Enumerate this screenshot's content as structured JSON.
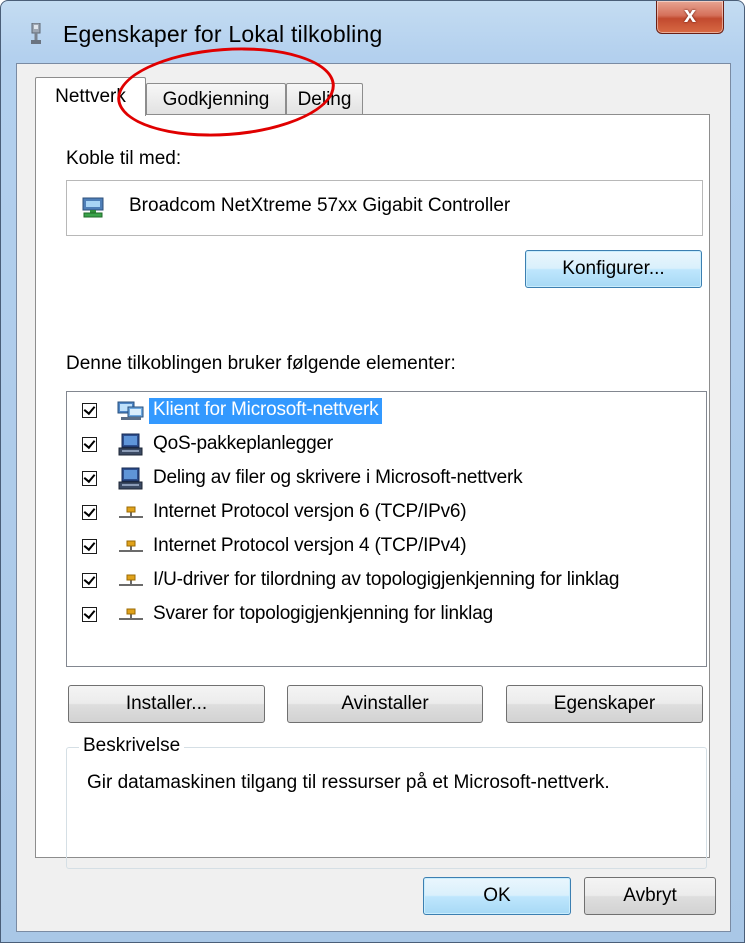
{
  "window": {
    "title": "Egenskaper for Lokal tilkobling",
    "close_label": "x"
  },
  "tabs": [
    {
      "label": "Nettverk",
      "active": true
    },
    {
      "label": "Godkjenning",
      "active": false
    },
    {
      "label": "Deling",
      "active": false
    }
  ],
  "connect_with": {
    "label": "Koble til med:",
    "adapter": "Broadcom NetXtreme 57xx Gigabit Controller",
    "configure_button": "Konfigurer..."
  },
  "components": {
    "label": "Denne tilkoblingen bruker følgende elementer:",
    "items": [
      {
        "label": "Klient for Microsoft-nettverk",
        "checked": true,
        "selected": true,
        "icon": "network-client-icon"
      },
      {
        "label": "QoS-pakkeplanlegger",
        "checked": true,
        "selected": false,
        "icon": "service-icon"
      },
      {
        "label": "Deling av filer og skrivere i Microsoft-nettverk",
        "checked": true,
        "selected": false,
        "icon": "service-icon"
      },
      {
        "label": "Internet Protocol versjon 6 (TCP/IPv6)",
        "checked": true,
        "selected": false,
        "icon": "protocol-icon"
      },
      {
        "label": "Internet Protocol versjon 4 (TCP/IPv4)",
        "checked": true,
        "selected": false,
        "icon": "protocol-icon"
      },
      {
        "label": "I/U-driver for tilordning av topologigjenkjenning for linklag",
        "checked": true,
        "selected": false,
        "icon": "protocol-icon"
      },
      {
        "label": "Svarer for topologigjenkjenning for linklag",
        "checked": true,
        "selected": false,
        "icon": "protocol-icon"
      }
    ]
  },
  "actions": {
    "install": "Installer...",
    "uninstall": "Avinstaller",
    "properties": "Egenskaper"
  },
  "description": {
    "title": "Beskrivelse",
    "text": "Gir datamaskinen tilgang til ressurser på et Microsoft-nettverk."
  },
  "footer": {
    "ok": "OK",
    "cancel": "Avbryt"
  },
  "colors": {
    "selection": "#3399ff",
    "annotation": "#e00000",
    "close_button": "#c24a2f"
  }
}
